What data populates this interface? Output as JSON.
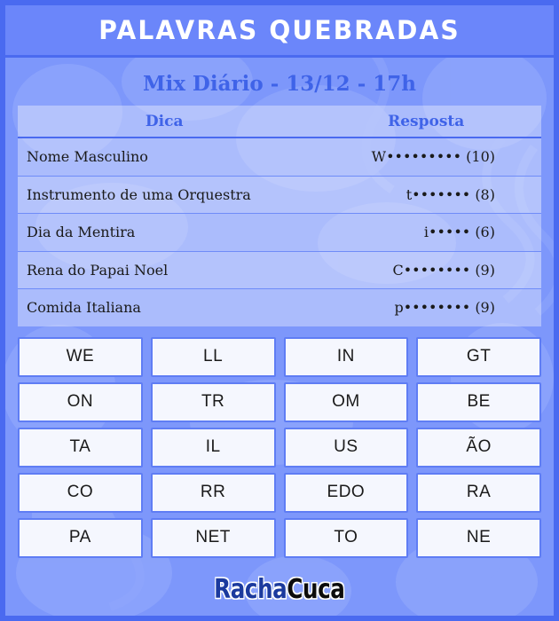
{
  "colors": {
    "frame_border": "#4a6af0",
    "body_bg": "#7d97fb",
    "title_bar_bg": "#6b86fa",
    "title_text": "#ffffff",
    "accent_blue": "#3f63e8",
    "tile_bg": "#f5f7fe",
    "tile_border": "#5f7df4",
    "text_dark": "#1a1a1a",
    "logo_racha": "#1b3a9e",
    "logo_cuca": "#0c0c0c"
  },
  "header": {
    "title": "PALAVRAS QUEBRADAS",
    "subtitle": "Mix Diário - 13/12 - 17h"
  },
  "table": {
    "columns": [
      "Dica",
      "Resposta"
    ],
    "rows": [
      {
        "clue": "Nome Masculino",
        "answer": "W••••••••• (10)"
      },
      {
        "clue": "Instrumento de uma Orquestra",
        "answer": "t••••••• (8)"
      },
      {
        "clue": "Dia da Mentira",
        "answer": "i••••• (6)"
      },
      {
        "clue": "Rena do Papai Noel",
        "answer": "C•••••••• (9)"
      },
      {
        "clue": "Comida Italiana",
        "answer": "p•••••••• (9)"
      }
    ]
  },
  "tiles": [
    "WE",
    "LL",
    "IN",
    "GT",
    "ON",
    "TR",
    "OM",
    "BE",
    "TA",
    "IL",
    "US",
    "ÃO",
    "CO",
    "RR",
    "EDO",
    "RA",
    "PA",
    "NET",
    "TO",
    "NE"
  ],
  "footer": {
    "logo_part1": "Racha",
    "logo_part2": "Cuca"
  }
}
